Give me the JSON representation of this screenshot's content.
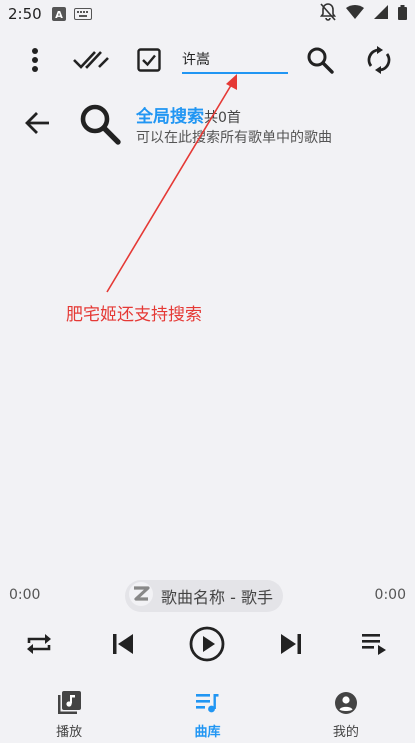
{
  "status_bar": {
    "time": "2:50",
    "icons": [
      "a-notification-icon",
      "keyboard-icon",
      "notifications-off-icon",
      "wifi-icon",
      "signal-icon",
      "battery-icon"
    ]
  },
  "toolbar": {
    "search_value": "许嵩",
    "icons": [
      "more-vert-icon",
      "done-all-icon",
      "checkbox-icon",
      "search-icon",
      "refresh-icon"
    ]
  },
  "header": {
    "title": "全局搜索",
    "count_text": "共0首",
    "subtitle": "可以在此搜索所有歌单中的歌曲"
  },
  "annotation": {
    "text": "肥宅姬还支持搜索",
    "color": "#e53935"
  },
  "player": {
    "time_elapsed": "0:00",
    "time_total": "0:00",
    "song_label": "歌曲名称 - 歌手"
  },
  "bottom_nav": {
    "items": [
      {
        "label": "播放",
        "icon": "music-library-icon",
        "active": false
      },
      {
        "label": "曲库",
        "icon": "playlist-music-icon",
        "active": true
      },
      {
        "label": "我的",
        "icon": "account-circle-icon",
        "active": false
      }
    ]
  },
  "colors": {
    "accent": "#2196f3",
    "background": "#f2f2f5",
    "annotation": "#e53935"
  }
}
